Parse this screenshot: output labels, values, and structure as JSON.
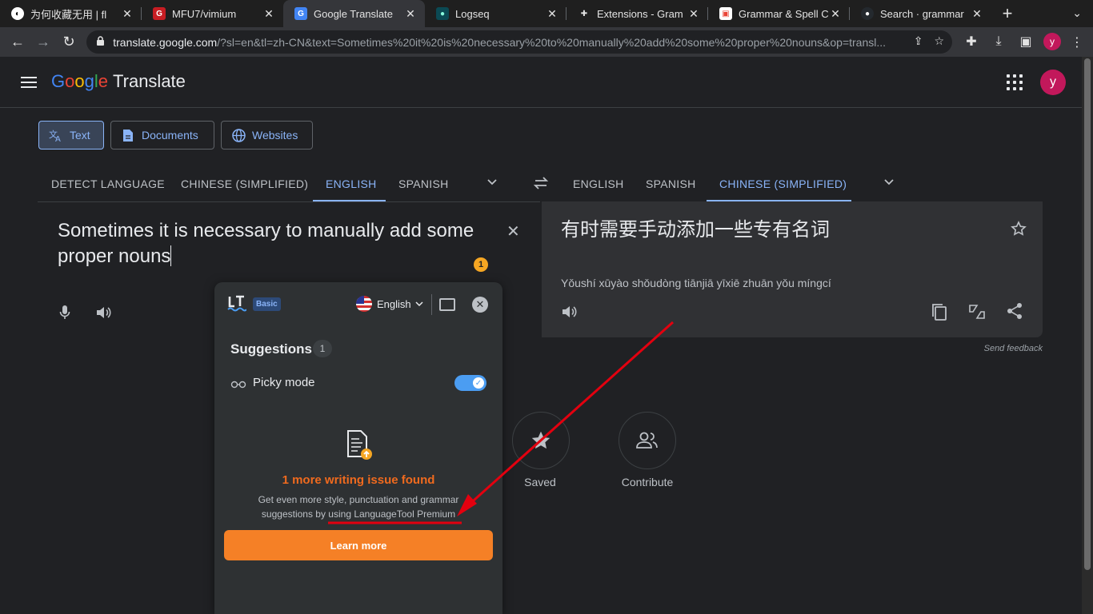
{
  "browser": {
    "tabs": [
      {
        "title": "为何收藏无用 | fl",
        "icon": "website-icon",
        "active": false
      },
      {
        "title": "MFU7/vimium",
        "icon": "gitee-icon",
        "active": false
      },
      {
        "title": "Google Translate",
        "icon": "google-translate-icon",
        "active": true
      },
      {
        "title": "Logseq",
        "icon": "logseq-icon",
        "active": false
      },
      {
        "title": "Extensions - Gram",
        "icon": "puzzle-icon",
        "active": false
      },
      {
        "title": "Grammar & Spell C",
        "icon": "chrome-store-icon",
        "active": false
      },
      {
        "title": "Search · grammar",
        "icon": "github-icon",
        "active": false
      }
    ],
    "url_host": "translate.google.com",
    "url_path": "/?sl=en&tl=zh-CN&text=Sometimes%20it%20is%20necessary%20to%20manually%20add%20some%20proper%20nouns&op=transl...",
    "profile_initial": "y"
  },
  "header": {
    "logo_letters": [
      "G",
      "o",
      "o",
      "g",
      "l",
      "e"
    ],
    "product": "Translate",
    "avatar_initial": "y"
  },
  "modes": {
    "text": "Text",
    "documents": "Documents",
    "websites": "Websites"
  },
  "source_langs": [
    "DETECT LANGUAGE",
    "CHINESE (SIMPLIFIED)",
    "ENGLISH",
    "SPANISH"
  ],
  "target_langs": [
    "ENGLISH",
    "SPANISH",
    "CHINESE (SIMPLIFIED)"
  ],
  "source": {
    "text": "Sometimes it is necessary to manually add some proper nouns",
    "issue_count": "1"
  },
  "target": {
    "text": "有时需要手动添加一些专有名词",
    "pinyin": "Yǒushí xūyào shǒudòng tiānjiā yīxiē zhuān yǒu míngcí"
  },
  "send_feedback": "Send feedback",
  "bottom": {
    "saved": "Saved",
    "contribute": "Contribute"
  },
  "languagetool": {
    "plan": "Basic",
    "language": "English",
    "suggestions_label": "Suggestions",
    "suggestions_count": "1",
    "picky_mode": "Picky mode",
    "picky_enabled": true,
    "issue_title": "1 more writing issue found",
    "issue_desc": "Get even more style, punctuation and grammar suggestions by using LanguageTool Premium",
    "learn_more": "Learn more",
    "accent_color": "#f58026"
  }
}
